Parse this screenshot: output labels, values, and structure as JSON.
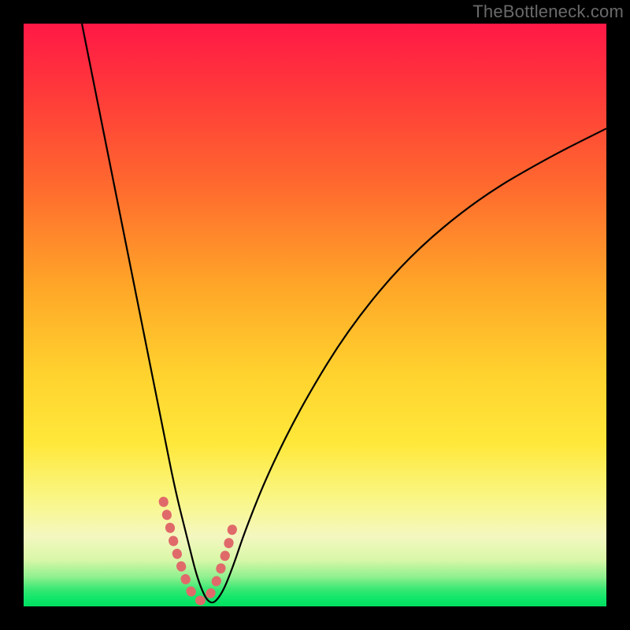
{
  "watermark": "TheBottleneck.com",
  "chart_data": {
    "type": "line",
    "title": "",
    "xlabel": "",
    "ylabel": "",
    "xlim": [
      0,
      100
    ],
    "ylim": [
      0,
      100
    ],
    "gradient_stops": [
      {
        "pct": 0,
        "color": "#ff1846"
      },
      {
        "pct": 12,
        "color": "#ff3a3a"
      },
      {
        "pct": 28,
        "color": "#ff6a2e"
      },
      {
        "pct": 45,
        "color": "#ffa628"
      },
      {
        "pct": 60,
        "color": "#ffd22e"
      },
      {
        "pct": 72,
        "color": "#ffe83a"
      },
      {
        "pct": 82,
        "color": "#f9f78a"
      },
      {
        "pct": 88,
        "color": "#f4f7c0"
      },
      {
        "pct": 92,
        "color": "#d9f7a8"
      },
      {
        "pct": 95,
        "color": "#8ef08e"
      },
      {
        "pct": 97,
        "color": "#3ae874"
      },
      {
        "pct": 98.5,
        "color": "#12e66a"
      },
      {
        "pct": 100,
        "color": "#00e060"
      }
    ],
    "series": [
      {
        "name": "main-curve",
        "color": "#000000",
        "x": [
          10,
          12,
          14,
          16,
          18,
          20,
          22,
          24,
          26,
          28,
          30,
          32,
          34,
          36,
          38,
          42,
          48,
          56,
          66,
          78,
          90,
          100
        ],
        "y": [
          100,
          90,
          80,
          70,
          60,
          50,
          40,
          30,
          20,
          12,
          4,
          0,
          2,
          7,
          13,
          23,
          35,
          48,
          60,
          70,
          77,
          82
        ]
      },
      {
        "name": "highlight-band",
        "color": "#e06a6a",
        "x": [
          24,
          25,
          26,
          27,
          28,
          29,
          30,
          31,
          32,
          33,
          34,
          35,
          36
        ],
        "y": [
          18,
          14,
          10,
          7,
          4,
          2,
          1,
          1,
          2,
          4,
          7,
          10,
          14
        ]
      }
    ],
    "annotations": []
  }
}
